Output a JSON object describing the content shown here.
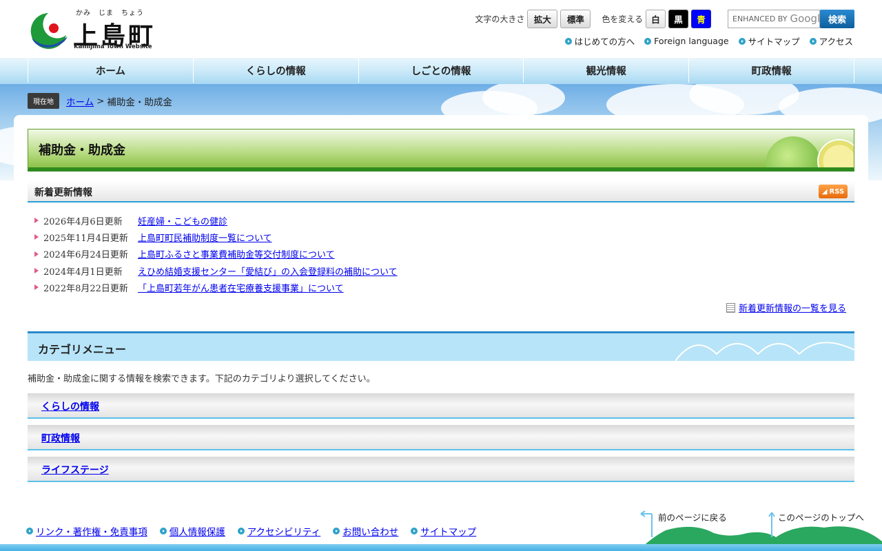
{
  "site": {
    "ruby": "かみ　じま　ちょう",
    "name": "上島町",
    "name_en": "Kamijima Town Website"
  },
  "tools": {
    "font_size_label": "文字の大きさ",
    "enlarge_label": "拡大",
    "standard_label": "標準",
    "color_label": "色を変える",
    "color_white": "白",
    "color_black": "黒",
    "color_blue": "青",
    "search_brand": "ENHANCED BY",
    "search_google": "Google",
    "search_button": "検索"
  },
  "sublinks": [
    "はじめての方へ",
    "Foreign language",
    "サイトマップ",
    "アクセス"
  ],
  "gnav": [
    "ホーム",
    "くらしの情報",
    "しごとの情報",
    "観光情報",
    "町政情報"
  ],
  "breadcrumb": {
    "tag": "現在地",
    "home": "ホーム",
    "sep": ">",
    "current": "補助金・助成金"
  },
  "page_title": "補助金・助成金",
  "news": {
    "heading": "新着更新情報",
    "rss": "RSS",
    "items": [
      {
        "date": "2026年4月6日更新",
        "title": "妊産婦・こどもの健診"
      },
      {
        "date": "2025年11月4日更新",
        "title": "上島町町民補助制度一覧について"
      },
      {
        "date": "2024年6月24日更新",
        "title": "上島町ふるさと事業費補助金等交付制度について"
      },
      {
        "date": "2024年4月1日更新",
        "title": "えひめ結婚支援センター「愛結び」の入会登録料の補助について"
      },
      {
        "date": "2022年8月22日更新",
        "title": "「上島町若年がん患者在宅療養支援事業」について"
      }
    ],
    "more": "新着更新情報の一覧を見る"
  },
  "category": {
    "heading": "カテゴリメニュー",
    "description": "補助金・助成金に関する情報を検索できます。下記のカテゴリより選択してください。",
    "items": [
      "くらしの情報",
      "町政情報",
      "ライフステージ"
    ]
  },
  "footer": {
    "links": [
      "リンク・著作権・免責事項",
      "個人情報保護",
      "アクセシビリティ",
      "お問い合わせ",
      "サイトマップ"
    ],
    "back": "前のページに戻る",
    "top": "このページのトップへ"
  },
  "colors": {
    "nav_bg": "#c7e8f8",
    "title_green": "#8dc24a",
    "accent_blue": "#2a9fd6",
    "link": "#0000ee"
  }
}
